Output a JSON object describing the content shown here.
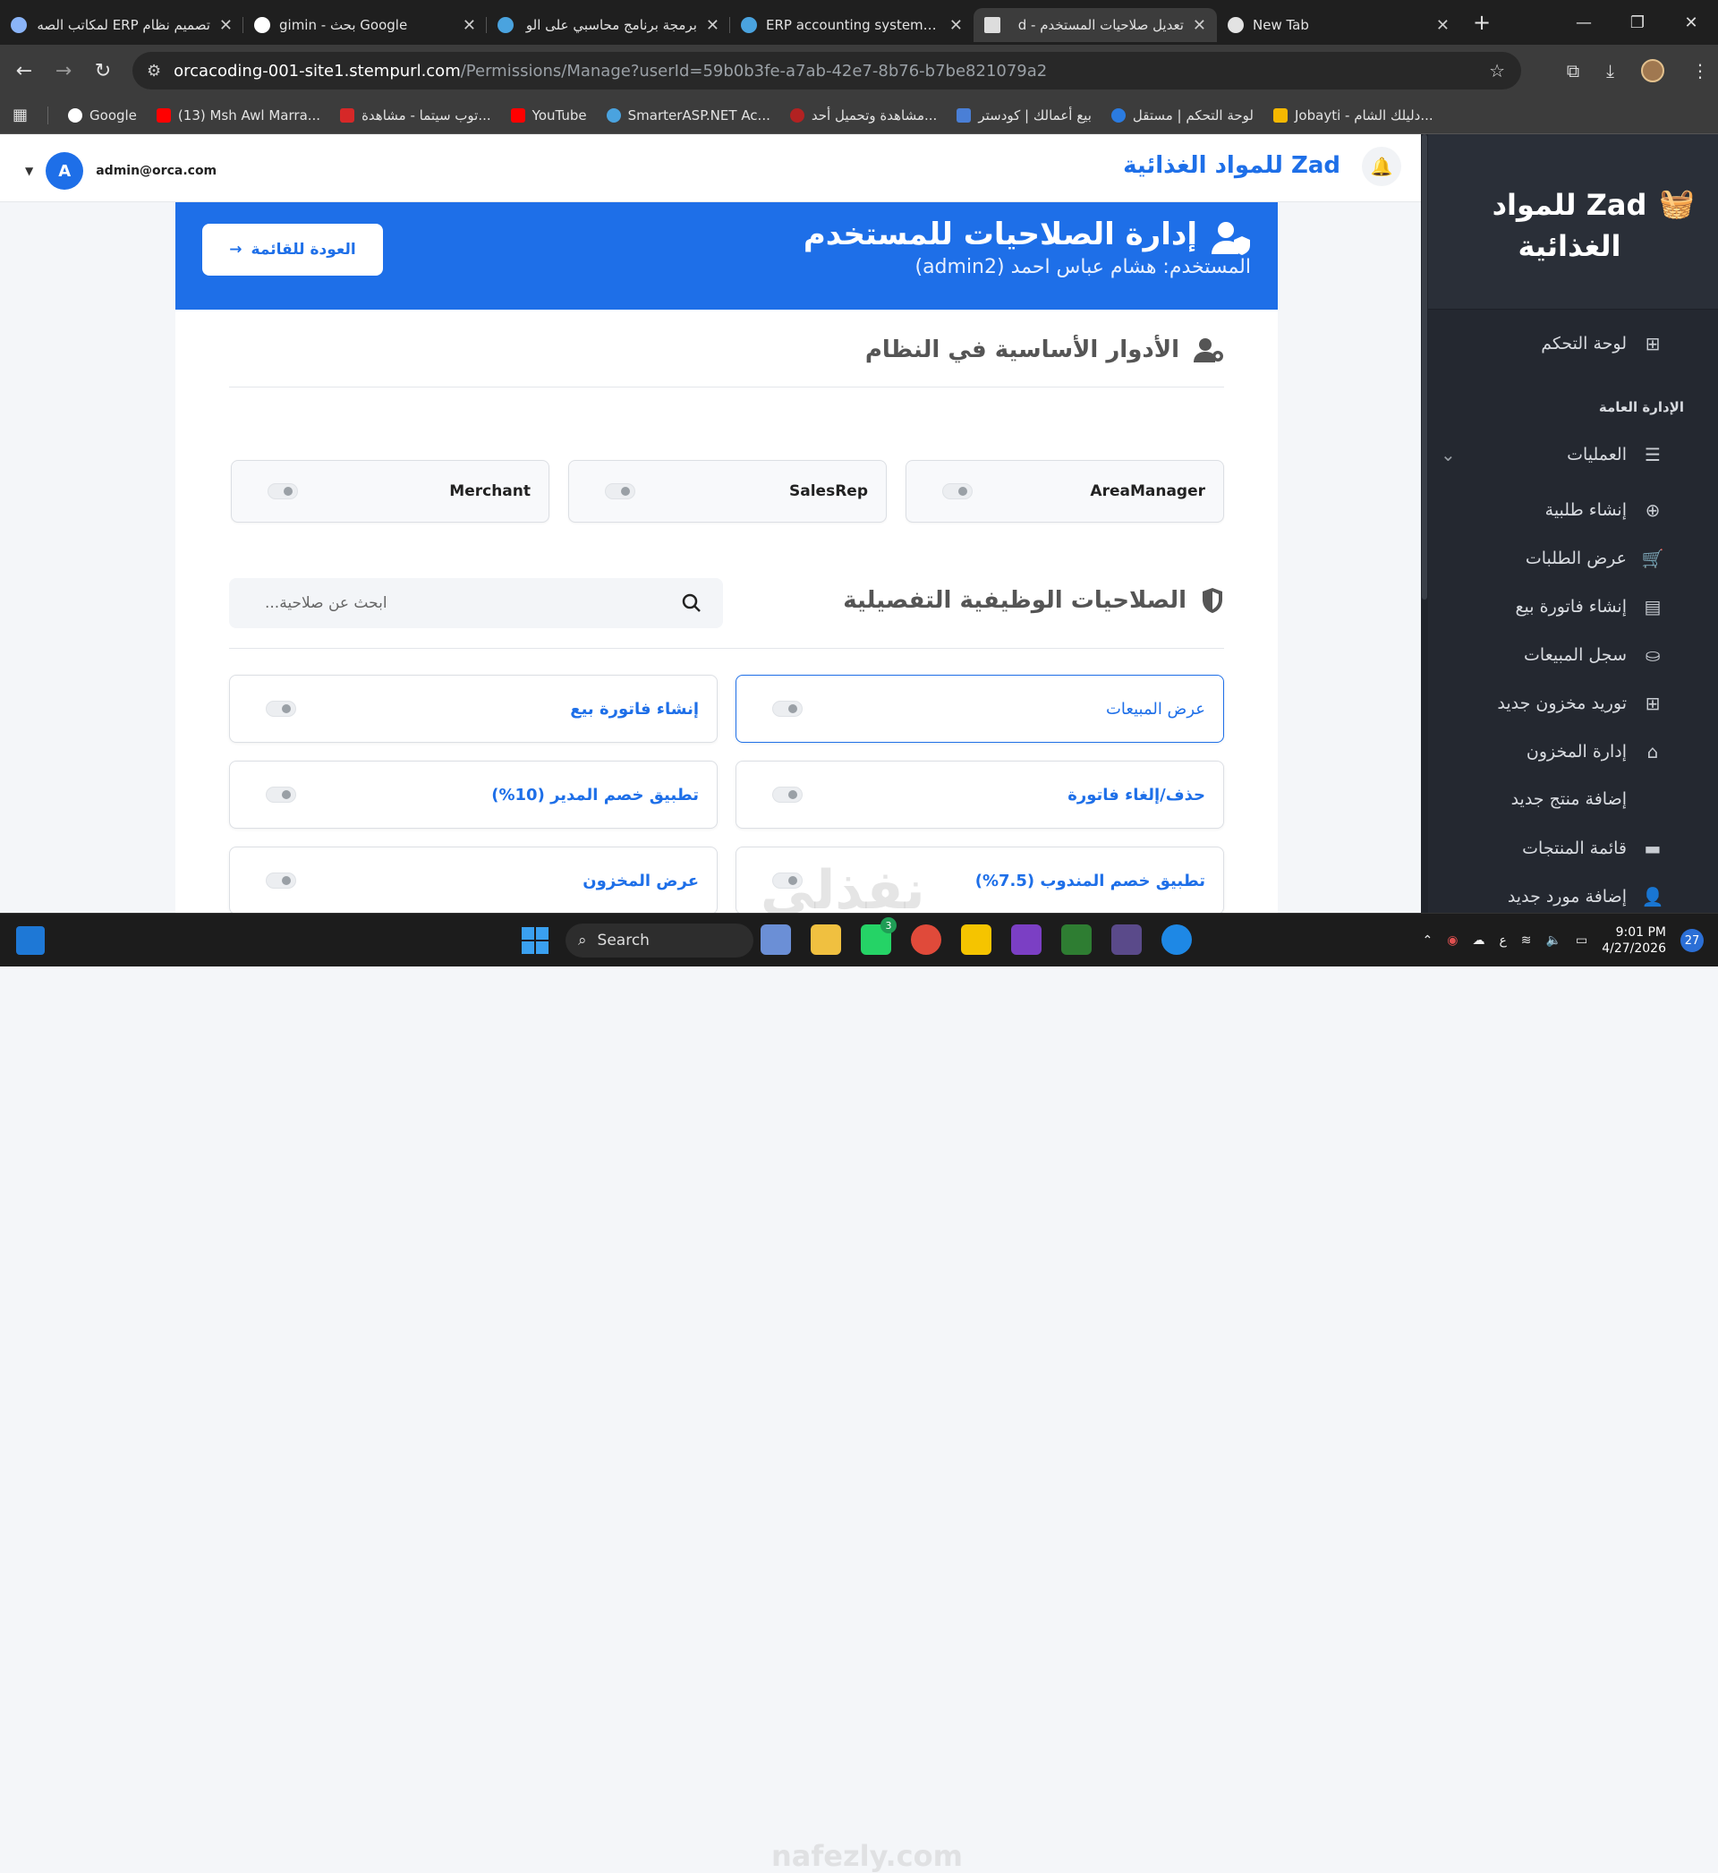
{
  "browser": {
    "tabs": [
      {
        "title": "تصميم نظام ERP لمكاتب الصه",
        "fav_color": "#8ab4f8"
      },
      {
        "title": "gimin - بحث Google",
        "fav_color": "#ffffff"
      },
      {
        "title": "برمجة برنامج محاسبي على الو",
        "fav_color": "#4aa3df"
      },
      {
        "title": "ERP accounting system for",
        "fav_color": "#4aa3df"
      },
      {
        "title": "تعديل صلاحيات المستخدم - d",
        "fav_color": "#dddddd",
        "active": true
      },
      {
        "title": "New Tab",
        "fav_color": "#e3e3e3"
      }
    ],
    "url_host": "orcacoding-001-site1.stempurl.com",
    "url_path": "/Permissions/Manage?userId=59b0b3fe-a7ab-42e7-8b76-b7be821079a2",
    "bookmarks": [
      {
        "label": "Google",
        "color": "#ffffff"
      },
      {
        "label": "(13) Msh Awl Marra...",
        "color": "#ff0000"
      },
      {
        "label": "توب سيتما - مشاهدة...",
        "color": "#d62828"
      },
      {
        "label": "YouTube",
        "color": "#ff0000"
      },
      {
        "label": "SmarterASP.NET Ac...",
        "color": "#4aa3df"
      },
      {
        "label": "مشاهدة وتحميل أحد...",
        "color": "#b22222"
      },
      {
        "label": "بيع أعمالك | كودستر",
        "color": "#4a7fd6"
      },
      {
        "label": "لوحة التحكم | مستقل",
        "color": "#2b7be0"
      },
      {
        "label": "Jobayti - دليلك الشام...",
        "color": "#f5b800"
      }
    ]
  },
  "topnav": {
    "user_email": "admin@orca.com",
    "user_initial": "A",
    "brand": "Zad للمواد الغذائية"
  },
  "hero": {
    "title": "إدارة الصلاحيات للمستخدم",
    "subtitle": "المستخدم: هشام عباس احمد (admin2)",
    "back_label": "العودة للقائمة"
  },
  "roles_section": {
    "title": "الأدوار الأساسية في النظام",
    "roles": [
      "AreaManager",
      "SalesRep",
      "Merchant"
    ]
  },
  "perms_section": {
    "title": "الصلاحيات الوظيفية التفصيلية",
    "search_placeholder": "ابحث عن صلاحية...",
    "perms": [
      {
        "label": "عرض المبيعات",
        "selected": true
      },
      {
        "label": "إنشاء فاتورة بيع"
      },
      {
        "label": "حذف/إلغاء فاتورة"
      },
      {
        "label": "تطبيق خصم المدير (10%)"
      },
      {
        "label": "تطبيق خصم المندوب (7.5%)"
      },
      {
        "label": "عرض المخزون"
      }
    ]
  },
  "sidebar": {
    "brand": "Zad للمواد الغذائية",
    "dashboard": "لوحة التحكم",
    "group": "الإدارة العامة",
    "operations": "العمليات",
    "items": [
      {
        "label": "إنشاء طلبية",
        "icon": "plus-circle-icon"
      },
      {
        "label": "عرض الطلبات",
        "icon": "cart-icon"
      },
      {
        "label": "إنشاء فاتورة بيع",
        "icon": "document-icon"
      },
      {
        "label": "سجل المبيعات",
        "icon": "basket-icon"
      },
      {
        "label": "توريد مخزون جديد",
        "icon": "plus-square-icon"
      },
      {
        "label": "إدارة المخزون",
        "icon": "warehouse-icon"
      },
      {
        "label": "إضافة منتج جديد",
        "icon": ""
      },
      {
        "label": "قائمة المنتجات",
        "icon": "box-icon"
      },
      {
        "label": "إضافة مورد جديد",
        "icon": "user-plus-icon"
      }
    ]
  },
  "taskbar": {
    "search": "Search",
    "time": "9:01 PM",
    "date": "4/27/2026",
    "notif_count": "27",
    "lang": "ع",
    "chat_badge": "3"
  },
  "watermark": {
    "arabic": "نفذلي",
    "latin": "nafezly.com"
  }
}
